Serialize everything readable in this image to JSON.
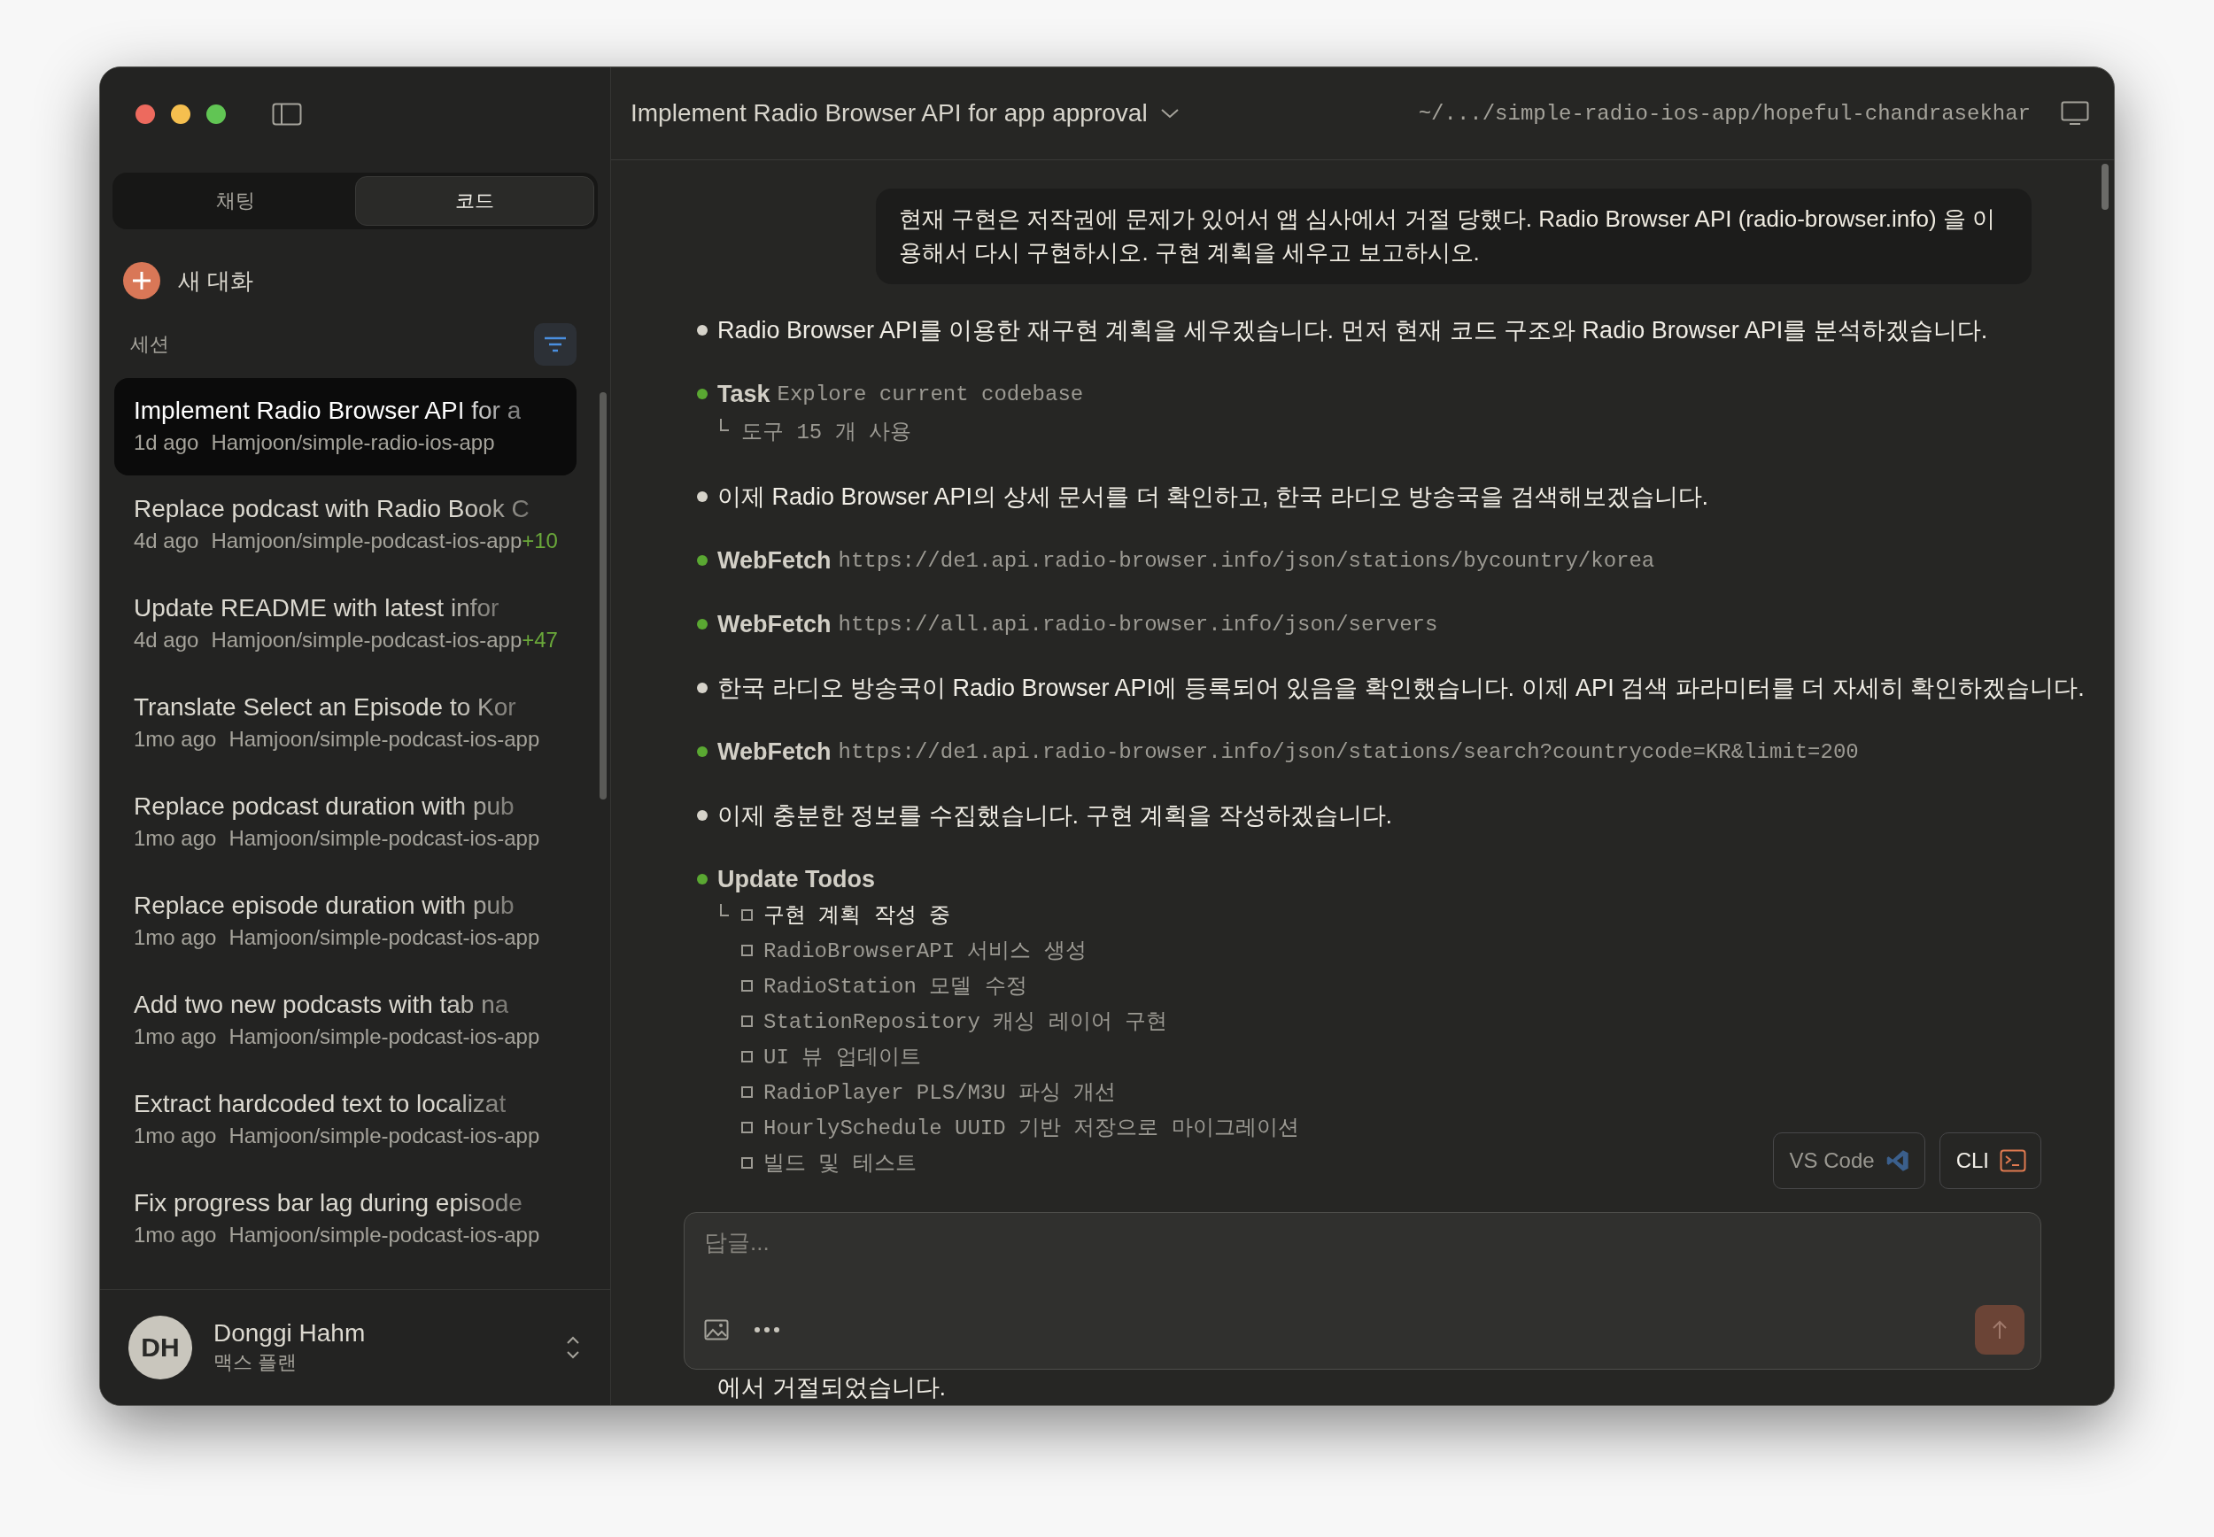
{
  "window": {
    "title": "Implement Radio Browser API for app approval",
    "path": "~/.../simple-radio-ios-app/hopeful-chandrasekhar"
  },
  "sidebar": {
    "tabs": [
      {
        "label": "채팅",
        "selected": false
      },
      {
        "label": "코드",
        "selected": true
      }
    ],
    "new_chat": "새 대화",
    "section_label": "세션",
    "sessions": [
      {
        "title": "Implement Radio Browser API for a",
        "age": "1d ago",
        "repo": "Hamjoon/simple-radio-ios-app",
        "selected": true
      },
      {
        "title": "Replace podcast with Radio Book C",
        "age": "4d ago",
        "repo": "Hamjoon/simple-podcast-ios-app",
        "extra": "+10",
        "selected": false
      },
      {
        "title": "Update README with latest infor",
        "age": "4d ago",
        "repo": "Hamjoon/simple-podcast-ios-app",
        "extra": "+47",
        "selected": false
      },
      {
        "title": "Translate Select an Episode to Kor",
        "age": "1mo ago",
        "repo": "Hamjoon/simple-podcast-ios-app",
        "selected": false
      },
      {
        "title": "Replace podcast duration with pub",
        "age": "1mo ago",
        "repo": "Hamjoon/simple-podcast-ios-app",
        "selected": false
      },
      {
        "title": "Replace episode duration with pub",
        "age": "1mo ago",
        "repo": "Hamjoon/simple-podcast-ios-app",
        "selected": false
      },
      {
        "title": "Add two new podcasts with tab na",
        "age": "1mo ago",
        "repo": "Hamjoon/simple-podcast-ios-app",
        "selected": false
      },
      {
        "title": "Extract hardcoded text to localizat",
        "age": "1mo ago",
        "repo": "Hamjoon/simple-podcast-ios-app",
        "selected": false
      },
      {
        "title": "Fix progress bar lag during episode",
        "age": "1mo ago",
        "repo": "Hamjoon/simple-podcast-ios-app",
        "selected": false
      }
    ],
    "user": {
      "initials": "DH",
      "name": "Donggi Hahm",
      "plan": "맥스 플랜"
    }
  },
  "conversation": {
    "user_message": "현재 구현은 저작권에 문제가 있어서 앱 심사에서 거절 당했다. Radio Browser API (radio-browser.info) 을 이용해서 다시 구현하시오. 구현 계획을 세우고 보고하시오.",
    "items": [
      {
        "kind": "text",
        "text": "Radio Browser API를 이용한 재구현 계획을 세우겠습니다. 먼저 현재 코드 구조와 Radio Browser API를 분석하겠습니다."
      },
      {
        "kind": "tool",
        "name": "Task",
        "argument": "Explore current codebase",
        "result": "도구 15 개 사용"
      },
      {
        "kind": "text",
        "text": "이제 Radio Browser API의 상세 문서를 더 확인하고, 한국 라디오 방송국을 검색해보겠습니다."
      },
      {
        "kind": "tool",
        "name": "WebFetch",
        "argument": "https://de1.api.radio-browser.info/json/stations/bycountry/korea"
      },
      {
        "kind": "tool",
        "name": "WebFetch",
        "argument": "https://all.api.radio-browser.info/json/servers"
      },
      {
        "kind": "text",
        "text": "한국 라디오 방송국이 Radio Browser API에 등록되어 있음을 확인했습니다. 이제 API 검색 파라미터를 더 자세히 확인하겠습니다."
      },
      {
        "kind": "tool",
        "name": "WebFetch",
        "argument": "https://de1.api.radio-browser.info/json/stations/search?countrycode=KR&limit=200"
      },
      {
        "kind": "text",
        "text": "이제 충분한 정보를 수집했습니다. 구현 계획을 작성하겠습니다."
      },
      {
        "kind": "todos",
        "name": "Update Todos",
        "todos": [
          {
            "text": "구현 계획 작성 중",
            "active": true,
            "checked": false
          },
          {
            "text": "RadioBrowserAPI 서비스 생성",
            "active": false,
            "checked": false
          },
          {
            "text": "RadioStation 모델 수정",
            "active": false,
            "checked": false
          },
          {
            "text": "StationRepository 캐싱 레이어 구현",
            "active": false,
            "checked": false
          },
          {
            "text": "UI 뷰 업데이트",
            "active": false,
            "checked": false
          },
          {
            "text": "RadioPlayer PLS/M3U 파싱 개선",
            "active": false,
            "checked": false
          },
          {
            "text": "HourlySchedule UUID 기반 저장으로 마이그레이션",
            "active": false,
            "checked": false
          },
          {
            "text": "빌드 및 테스트",
            "active": false,
            "checked": false
          }
        ]
      }
    ],
    "trailing_text": "에서 거절되었습니다."
  },
  "open_buttons": [
    {
      "kind": "vscode",
      "label": "VS Code",
      "disabled": true
    },
    {
      "kind": "cli",
      "label": "CLI",
      "disabled": false
    }
  ],
  "composer": {
    "placeholder": "답글...",
    "send_disabled": true
  }
}
